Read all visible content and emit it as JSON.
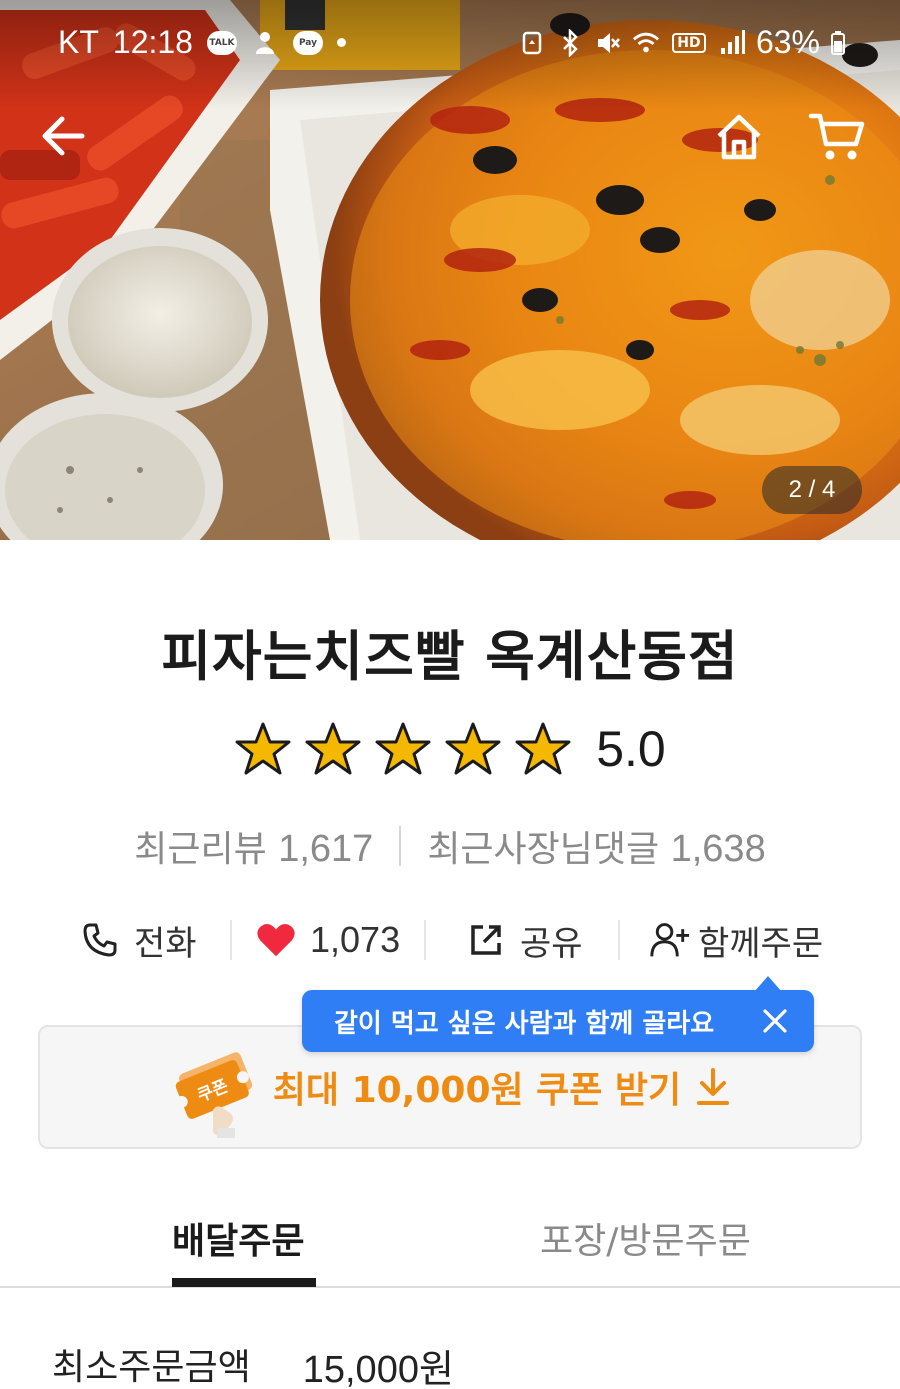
{
  "status_bar": {
    "carrier": "KT",
    "time": "12:18",
    "talk_badge": "TALK",
    "pay_badge": "Pay",
    "network": "HD",
    "battery": "63%"
  },
  "hero": {
    "image_counter": "2 / 4"
  },
  "store": {
    "name": "피자는치즈빨 옥계산동점",
    "rating": "5.0",
    "stars_filled": 5,
    "stars_total": 5,
    "recent_reviews_label": "최근리뷰",
    "recent_reviews_count": "1,617",
    "owner_replies_label": "최근사장님댓글",
    "owner_replies_count": "1,638"
  },
  "actions": {
    "call_label": "전화",
    "like_count": "1,073",
    "share_label": "공유",
    "group_order_label": "함께주문"
  },
  "tooltip": {
    "text": "같이 먹고 싶은 사람과 함께 골라요"
  },
  "coupon": {
    "art_text": "쿠폰",
    "label": "최대 10,000원 쿠폰 받기"
  },
  "tabs": {
    "delivery": "배달주문",
    "pickup": "포장/방문주문",
    "active": "delivery"
  },
  "order_info": {
    "min_order_label": "최소주문금액",
    "min_order_value": "15,000원"
  },
  "colors": {
    "star": "#F5B800",
    "heart": "#F0293E",
    "tooltip": "#2F7EF5",
    "coupon_accent": "#EE8B12"
  }
}
